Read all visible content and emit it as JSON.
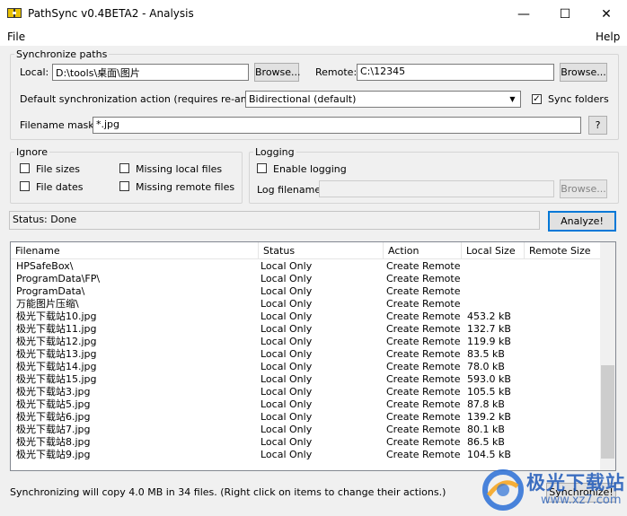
{
  "window": {
    "title": "PathSync v0.4BETA2 - Analysis",
    "minimize": "—",
    "maximize": "☐",
    "close": "✕"
  },
  "menu": {
    "file": "File",
    "help": "Help"
  },
  "sync_paths": {
    "legend": "Synchronize paths",
    "local_label": "Local:",
    "local_value": "D:\\tools\\桌面\\图片",
    "browse1": "Browse...",
    "remote_label": "Remote:",
    "remote_value": "C:\\12345",
    "browse2": "Browse...",
    "default_action_label": "Default synchronization action (requires re-analyze):",
    "default_action_value": "Bidirectional (default)",
    "sync_folders_label": "Sync folders",
    "sync_folders_checked": true,
    "mask_label": "Filename mask:",
    "mask_value": "*.jpg",
    "mask_help": "?"
  },
  "ignore": {
    "legend": "Ignore",
    "file_sizes": "File sizes",
    "file_dates": "File dates",
    "missing_local": "Missing local files",
    "missing_remote": "Missing remote files"
  },
  "logging": {
    "legend": "Logging",
    "enable": "Enable logging",
    "filename_label": "Log filename:",
    "browse": "Browse..."
  },
  "status": "Status: Done",
  "analyze": "Analyze!",
  "columns": [
    "Filename",
    "Status",
    "Action",
    "Local Size",
    "Remote Size"
  ],
  "rows": [
    [
      "HPSafeBox\\",
      "Local Only",
      "Create Remote",
      ""
    ],
    [
      "ProgramData\\FP\\",
      "Local Only",
      "Create Remote",
      ""
    ],
    [
      "ProgramData\\",
      "Local Only",
      "Create Remote",
      ""
    ],
    [
      "万能图片压缩\\",
      "Local Only",
      "Create Remote",
      ""
    ],
    [
      "极光下载站10.jpg",
      "Local Only",
      "Create Remote",
      "453.2 kB"
    ],
    [
      "极光下载站11.jpg",
      "Local Only",
      "Create Remote",
      "132.7 kB"
    ],
    [
      "极光下载站12.jpg",
      "Local Only",
      "Create Remote",
      "119.9 kB"
    ],
    [
      "极光下载站13.jpg",
      "Local Only",
      "Create Remote",
      "83.5 kB"
    ],
    [
      "极光下载站14.jpg",
      "Local Only",
      "Create Remote",
      "78.0 kB"
    ],
    [
      "极光下载站15.jpg",
      "Local Only",
      "Create Remote",
      "593.0 kB"
    ],
    [
      "极光下载站3.jpg",
      "Local Only",
      "Create Remote",
      "105.5 kB"
    ],
    [
      "极光下载站5.jpg",
      "Local Only",
      "Create Remote",
      "87.8 kB"
    ],
    [
      "极光下载站6.jpg",
      "Local Only",
      "Create Remote",
      "139.2 kB"
    ],
    [
      "极光下载站7.jpg",
      "Local Only",
      "Create Remote",
      "80.1 kB"
    ],
    [
      "极光下载站8.jpg",
      "Local Only",
      "Create Remote",
      "86.5 kB"
    ],
    [
      "极光下载站9.jpg",
      "Local Only",
      "Create Remote",
      "104.5 kB"
    ]
  ],
  "footer": "Synchronizing will copy 4.0 MB in 34 files. (Right click on items to change their actions.)",
  "synchronize": "Synchronize!",
  "watermark": {
    "text": "极光下载站",
    "url": "www.xz7.com"
  }
}
